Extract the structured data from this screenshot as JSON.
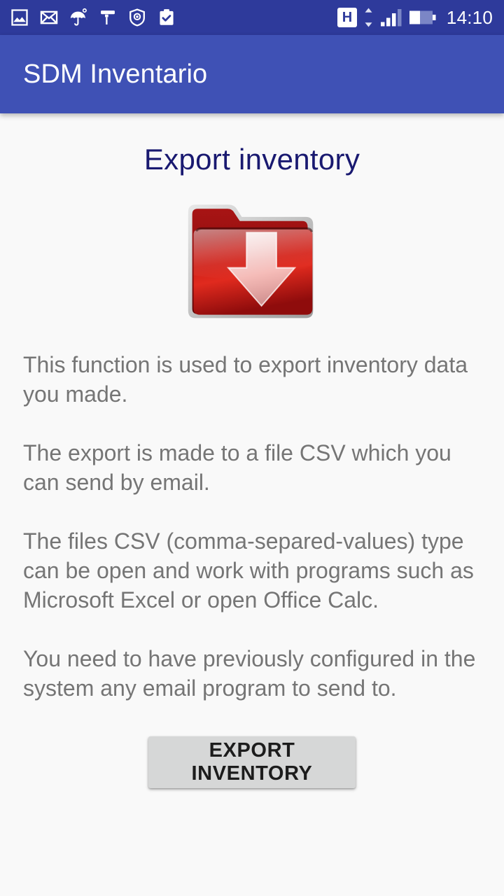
{
  "status_bar": {
    "background_color": "#2e3a9b",
    "time": "14:10",
    "network_type": "H",
    "icons": [
      "image-icon",
      "envelope-icon",
      "umbrella-icon",
      "paint-roller-icon",
      "shield-icon",
      "clipboard-check-icon"
    ],
    "data_arrows": "up-down-arrows-icon",
    "signal_bars": 3,
    "signal_bars_total": 4,
    "battery_level_percent": 55
  },
  "app_bar": {
    "title": "SDM Inventario",
    "background_color": "#3f51b5",
    "text_color": "#ffffff"
  },
  "main": {
    "page_title": "Export inventory",
    "page_title_color": "#191970",
    "hero_icon": "red-folder-download-icon",
    "paragraphs": [
      "This function is used to export inventory data you made.",
      "The export is made to a file CSV which you can send by email.",
      "The files CSV (comma-separed-values) type can be open and work with programs such as Microsoft Excel or open Office Calc.",
      "You need to have previously configured in the system any email program to send to."
    ],
    "paragraph_color": "#757575",
    "export_button": {
      "label": "EXPORT INVENTORY",
      "background_color": "#d6d7d7",
      "text_color": "#1c1c1c"
    }
  }
}
